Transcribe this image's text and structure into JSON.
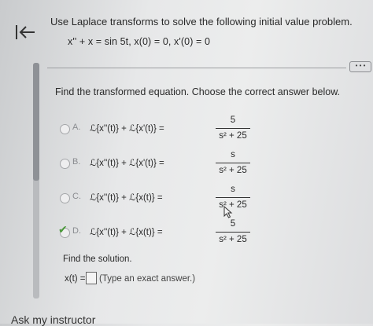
{
  "question": {
    "prompt": "Use Laplace transforms to solve the following initial value problem.",
    "ivp": "x'' + x = sin 5t, x(0) = 0, x'(0) = 0"
  },
  "more_button_label": "• • •",
  "instruction": "Find the transformed equation. Choose the correct answer below.",
  "options": [
    {
      "letter": "A.",
      "lhs": "ℒ{x''(t)} + ℒ{x'(t)} =",
      "numerator": "5",
      "denominator": "s² + 25",
      "selected": false
    },
    {
      "letter": "B.",
      "lhs": "ℒ{x''(t)} + ℒ{x'(t)} =",
      "numerator": "s",
      "denominator": "s² + 25",
      "selected": false
    },
    {
      "letter": "C.",
      "lhs": "ℒ{x''(t)} + ℒ{x(t)} =",
      "numerator": "s",
      "denominator": "s² + 25",
      "selected": false
    },
    {
      "letter": "D.",
      "lhs": "ℒ{x''(t)} + ℒ{x(t)} =",
      "numerator": "5",
      "denominator": "s² + 25",
      "selected": true
    }
  ],
  "solution": {
    "heading": "Find the solution.",
    "label": "x(t) =",
    "hint": "(Type an exact answer.)"
  },
  "ask_instructor": "Ask my instructor",
  "colors": {
    "check": "#4b9a3b",
    "background": "#e7e8e9"
  }
}
